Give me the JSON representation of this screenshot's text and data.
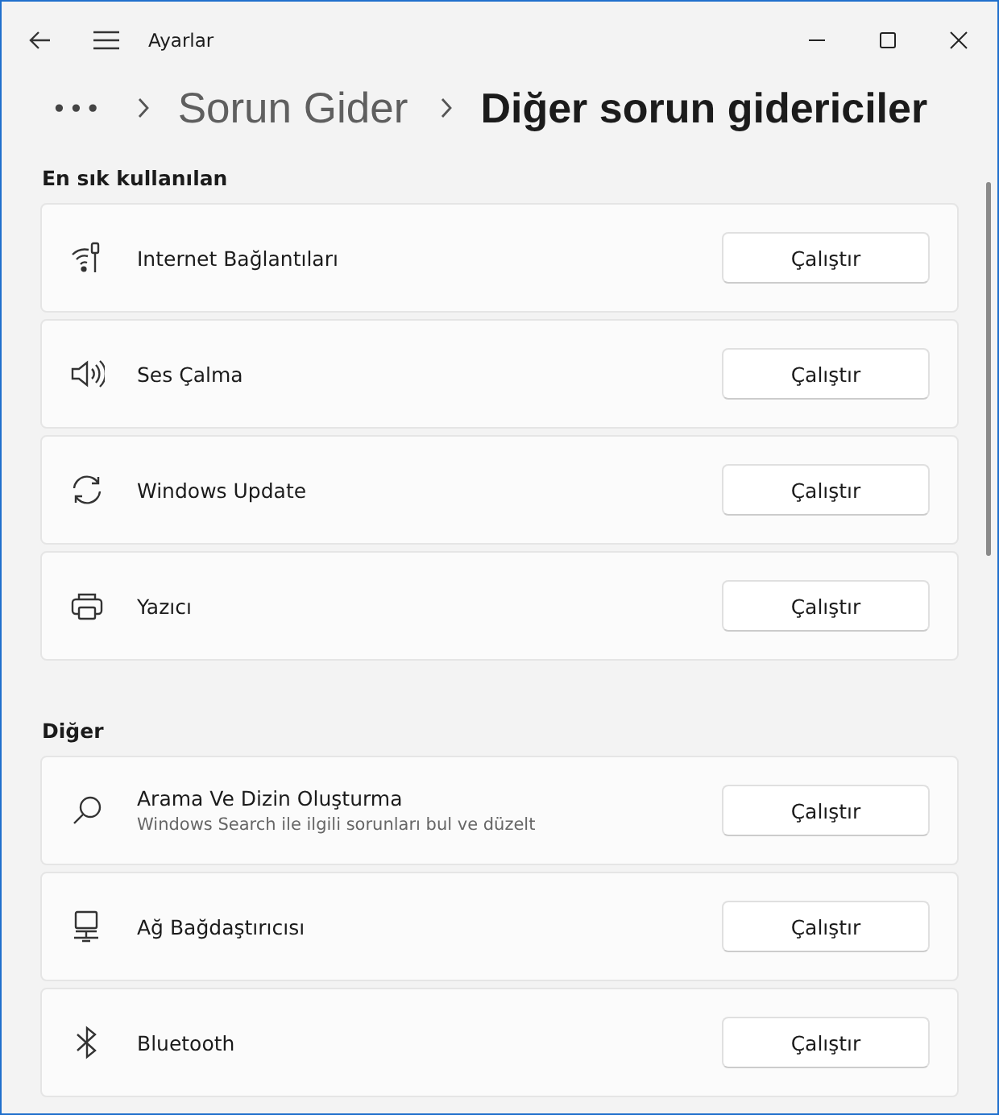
{
  "window": {
    "title": "Ayarlar"
  },
  "breadcrumb": {
    "more": "•••",
    "items": [
      "Sorun Gider",
      "Diğer sorun gidericiler"
    ]
  },
  "sections": [
    {
      "heading": "En sık kullanılan",
      "items": [
        {
          "title": "Internet Bağlantıları",
          "button": "Çalıştır"
        },
        {
          "title": "Ses Çalma",
          "button": "Çalıştır"
        },
        {
          "title": "Windows Update",
          "button": "Çalıştır"
        },
        {
          "title": "Yazıcı",
          "button": "Çalıştır"
        }
      ]
    },
    {
      "heading": "Diğer",
      "items": [
        {
          "title": "Arama Ve Dizin Oluşturma",
          "subtitle": "Windows Search ile ilgili sorunları bul ve düzelt",
          "button": "Çalıştır"
        },
        {
          "title": "Ağ Bağdaştırıcısı",
          "button": "Çalıştır"
        },
        {
          "title": "Bluetooth",
          "button": "Çalıştır"
        }
      ]
    }
  ]
}
